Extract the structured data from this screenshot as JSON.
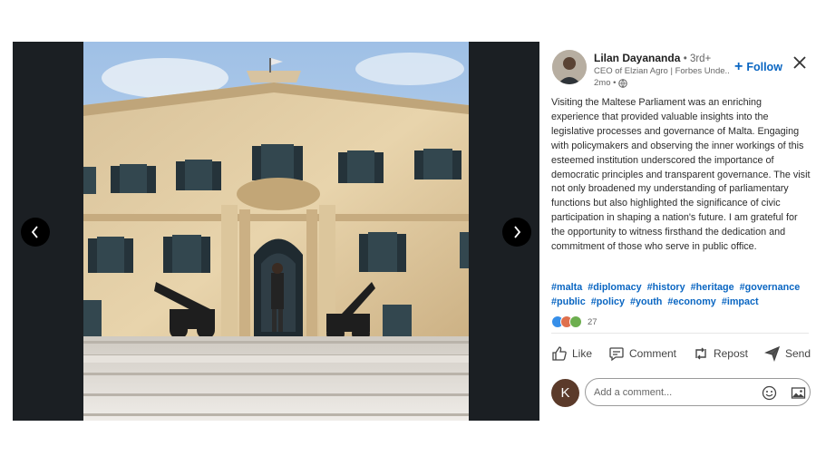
{
  "post": {
    "author_name": "Lilan Dayananda",
    "author_degree": "• 3rd+",
    "author_headline": "CEO of Elzian Agro | Forbes Unde...",
    "post_time": "2mo •",
    "follow_label": "Follow",
    "body": "Visiting the Maltese Parliament was an enriching experience that provided valuable insights into the legislative processes and governance of Malta. Engaging with policymakers and observing the inner workings of this esteemed institution underscored the importance of democratic principles and transparent governance. The visit not only broadened my understanding of parliamentary functions but also highlighted the significance of civic participation in shaping a nation's future. I am grateful for the opportunity to witness firsthand the dedication and commitment of those who serve in public office.",
    "hashtags": [
      "#malta",
      "#diplomacy",
      "#history",
      "#heritage",
      "#governance",
      "#public",
      "#policy",
      "#youth",
      "#economy",
      "#impact"
    ],
    "reaction_count": "27"
  },
  "actions": {
    "like": "Like",
    "comment": "Comment",
    "repost": "Repost",
    "send": "Send"
  },
  "comment": {
    "avatar_letter": "K",
    "placeholder": "Add a comment..."
  },
  "icons": {
    "prev": "chevron-left-icon",
    "next": "chevron-right-icon",
    "close": "close-icon",
    "globe": "globe-icon",
    "emoji": "emoji-icon",
    "image": "image-icon"
  },
  "colors": {
    "accent": "#0a66c2",
    "viewer_bg": "#1b1f23"
  }
}
